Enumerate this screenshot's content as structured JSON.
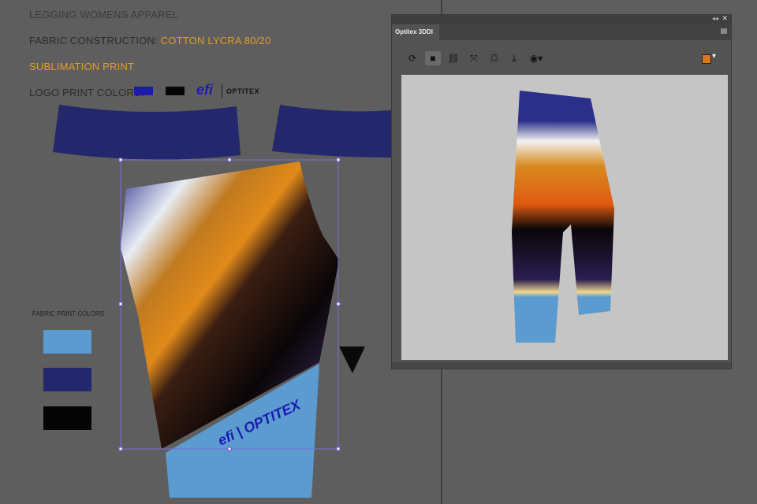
{
  "artboard": {
    "title": "LEGGING WOMENS APPAREL",
    "fabric_label": "FABRIC CONSTRUCTION: ",
    "fabric_value": "COTTON LYCRA 80/20",
    "print_type": "SUBLIMATION PRINT",
    "logo_colors_label": "LOGO PRINT COLORS:",
    "logo_colors": [
      "#1c1ca8",
      "#050505"
    ],
    "logo": {
      "brand1": "efi",
      "brand2": "OPTITEX"
    },
    "fabric_print_colors_label": "FABRIC PRINT COLORS",
    "fabric_print_colors": [
      "#5b9bd0",
      "#23276b",
      "#050505"
    ]
  },
  "panel": {
    "tab_label": "Optitex 3DDI",
    "titlebar_icons": [
      "collapse-icon",
      "close-icon"
    ],
    "toolbar": [
      {
        "name": "refresh-icon",
        "glyph": "⟳"
      },
      {
        "name": "folder-icon",
        "glyph": "■"
      },
      {
        "name": "link-icon",
        "glyph": "⛓"
      },
      {
        "name": "fit-screen-icon",
        "glyph": "⤧"
      },
      {
        "name": "paint-bucket-icon",
        "glyph": "⛋"
      },
      {
        "name": "download-icon",
        "glyph": "⤓"
      },
      {
        "name": "camera-icon",
        "glyph": "◉▾"
      }
    ],
    "render_mode_glyph": "▾"
  }
}
